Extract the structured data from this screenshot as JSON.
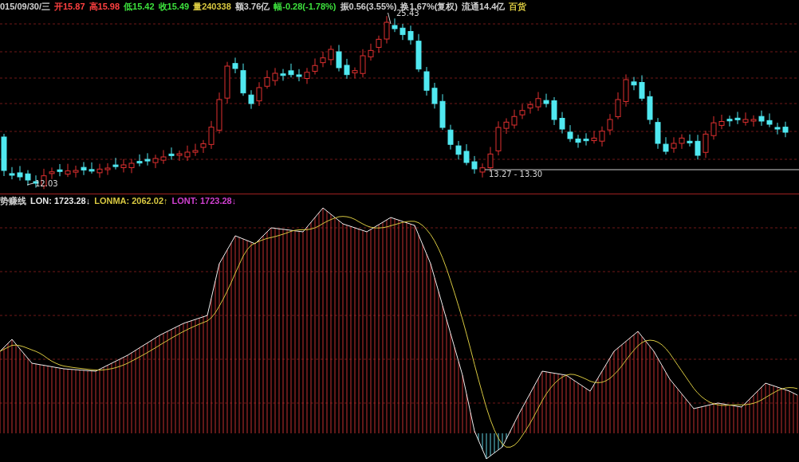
{
  "quote_bar": {
    "date": "015/09/30/三",
    "items": [
      {
        "label": "开",
        "value": "15.87",
        "color": "#ff4040"
      },
      {
        "label": "高",
        "value": "15.98",
        "color": "#ff4040"
      },
      {
        "label": "低",
        "value": "15.42",
        "color": "#3ce03c"
      },
      {
        "label": "收",
        "value": "15.49",
        "color": "#3ce03c"
      },
      {
        "label": "量",
        "value": "240338",
        "color": "#d8c840"
      },
      {
        "label": "额",
        "value": "3.76亿",
        "color": "#d0d0d0"
      },
      {
        "label": "幅",
        "value": "-0.28(-1.78%)",
        "color": "#3ce03c"
      },
      {
        "label": "振",
        "value": "0.56(3.55%)",
        "color": "#d0d0d0"
      },
      {
        "label": "换",
        "value": "1.67%(复权)",
        "color": "#d0d0d0"
      },
      {
        "label": "流通",
        "value": "14.4亿",
        "color": "#d0d0d0"
      }
    ],
    "sector": "百货"
  },
  "price_annotations": {
    "high": "25.43",
    "low": "12.03",
    "range": "13.27 - 13.30"
  },
  "indicator": {
    "name": "势赚线",
    "lines": [
      {
        "label": "LON: 1723.28",
        "arrow": "↓",
        "color": "#e8e8e8"
      },
      {
        "label": "LONMA: 2062.02",
        "arrow": "↑",
        "color": "#d8c840"
      },
      {
        "label": "LONT: 1723.28",
        "arrow": "↓",
        "color": "#d040d0"
      }
    ]
  }
}
